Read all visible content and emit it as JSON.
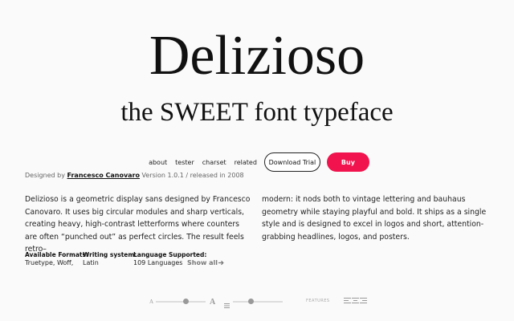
{
  "hero": {
    "title": "Delizioso",
    "subtitle": "the SWEET font typeface"
  },
  "nav": {
    "links": [
      "about",
      "tester",
      "charset",
      "related"
    ],
    "download_trial": "Download Trial",
    "buy": "Buy"
  },
  "credit": {
    "prefix": "Designed by",
    "designer": "Francesco Canovaro",
    "version": "Version 1.0.1 / released in 2008"
  },
  "description": {
    "col1": "Delizioso is a geometric display sans designed by Francesco Canovaro. It uses big circular modules and sharp verticals, creating heavy, high-contrast letterforms where counters are often “punched out” as perfect circles. The result feels retro–",
    "col2": "modern: it nods both to vintage lettering and bauhaus geometry while staying playful and bold. It ships as a single style and is designed to excel in logos and short, attention-grabbing headlines, logos, and posters."
  },
  "meta": {
    "formats_label": "Available Formats:",
    "formats_value": "Truetype, Woff,",
    "writing_label": "Writing system:",
    "writing_value": "Latin",
    "lang_label": "Language Supported:",
    "lang_value": "109 Languages",
    "show_all": "Show all",
    "show_all_icon": "arrow-right-icon"
  },
  "toolbar": {
    "size_small": "A",
    "size_large": "A",
    "features_label": "FEATURES"
  },
  "colors": {
    "accent": "#f0134d",
    "text": "#111111",
    "muted": "#666666"
  }
}
